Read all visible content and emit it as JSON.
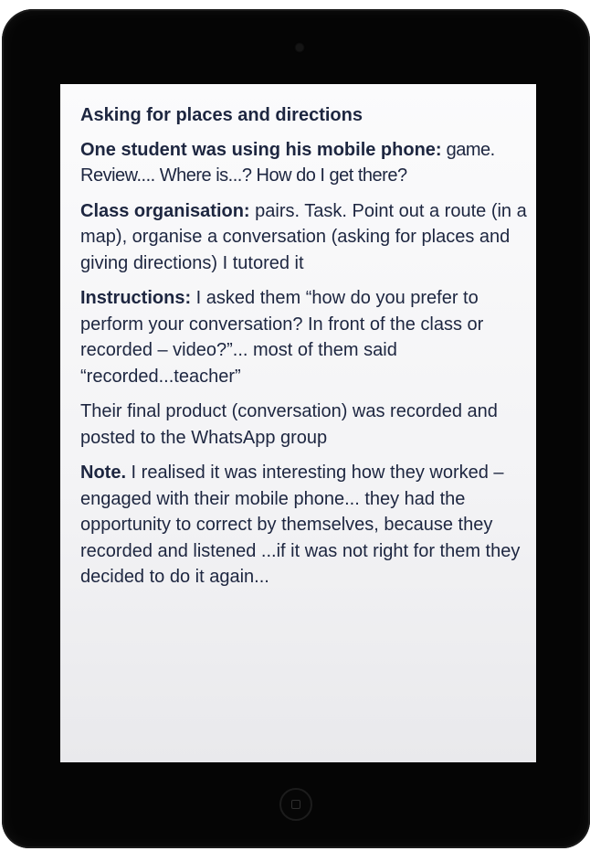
{
  "slide": {
    "title": "Asking for places and directions",
    "paragraphs": [
      {
        "heading": "One student was using his mobile phone:",
        "text": " game. Review.... Where is...? How do I get there?"
      },
      {
        "heading": "Class organisation:",
        "text": " pairs. Task. Point out a route (in a map), organise a conversation (asking for places and giving directions) I tutored it"
      },
      {
        "heading": "Instructions:",
        "text": " I asked them “how do you prefer to perform your conversation? In front of the class or recorded – video?”... most of them said “recorded...teacher”"
      },
      {
        "heading": "",
        "text": "Their final product (conversation) was recorded and posted to the WhatsApp group"
      },
      {
        "heading": "Note.",
        "text": " I realised it was interesting how they worked – engaged with their mobile phone... they had the opportunity to correct by themselves, because they recorded and listened ...if it was not right for them they decided to do it again..."
      }
    ]
  },
  "colors": {
    "text": "#1d2640",
    "bezel": "#050505",
    "screen": "#f3f3f5"
  }
}
